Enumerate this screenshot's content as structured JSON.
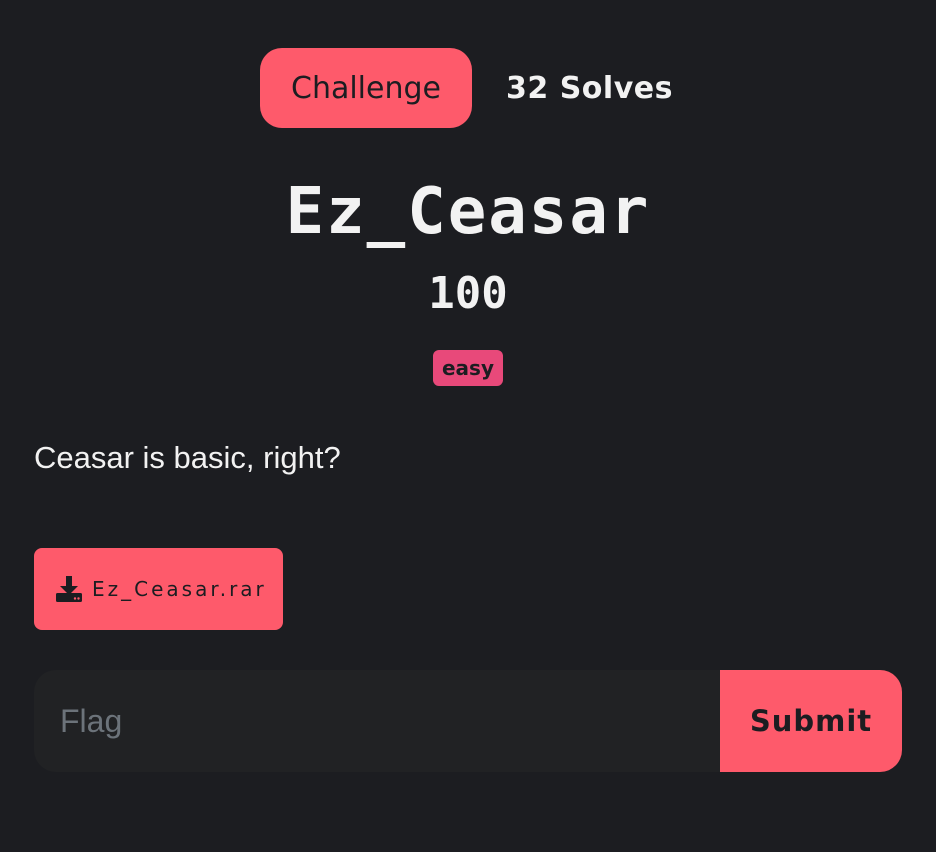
{
  "tabs": {
    "challenge_label": "Challenge",
    "solves_label": "32 Solves"
  },
  "challenge": {
    "name": "Ez_Ceasar",
    "points": "100",
    "difficulty": "easy",
    "description": "Ceasar is basic, right?"
  },
  "attachment": {
    "icon": "download-icon",
    "filename": "Ez_Ceasar.rar"
  },
  "flag_form": {
    "placeholder": "Flag",
    "value": "",
    "submit_label": "Submit"
  },
  "colors": {
    "background": "#1c1d21",
    "accent": "#fe5a6b",
    "badge": "#e8497a",
    "input_background": "#212224",
    "text": "#f2f2f2",
    "placeholder": "#6c737a"
  }
}
